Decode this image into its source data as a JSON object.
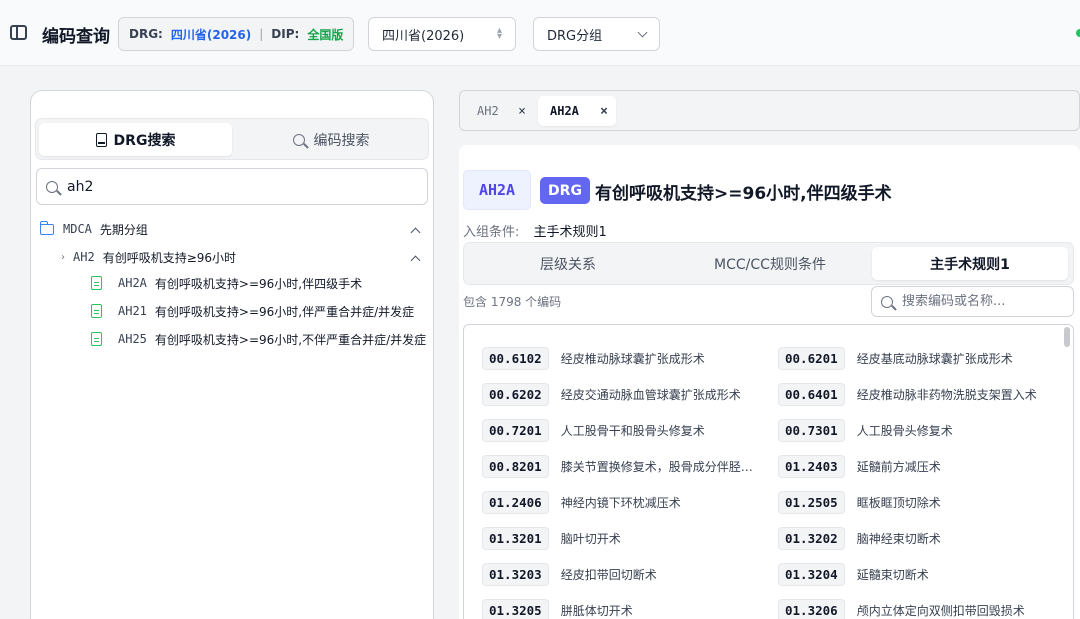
{
  "header": {
    "title": "编码查询",
    "drg_key": "DRG:",
    "drg_value": "四川省(2026)",
    "separator": "|",
    "dip_key": "DIP:",
    "dip_value": "全国版",
    "province_select": "四川省(2026)",
    "group_select": "DRG分组"
  },
  "left": {
    "tabs": [
      "DRG搜索",
      "编码搜索"
    ],
    "search_value": "ah2",
    "tree": {
      "mdca_code": "MDCA",
      "mdca_name": "先期分组",
      "adrg_code": "AH2",
      "adrg_name": "有创呼吸机支持≥96小时",
      "children": [
        {
          "code": "AH2A",
          "name": "有创呼吸机支持>=96小时,伴四级手术"
        },
        {
          "code": "AH21",
          "name": "有创呼吸机支持>=96小时,伴严重合并症/并发症"
        },
        {
          "code": "AH25",
          "name": "有创呼吸机支持>=96小时,不伴严重合并症/并发症"
        }
      ]
    }
  },
  "right": {
    "open_tabs": [
      "AH2",
      "AH2A"
    ],
    "close_glyph": "×",
    "code": "AH2A",
    "type_chip": "DRG",
    "title": "有创呼吸机支持>=96小时,伴四级手术",
    "condition_label": "入组条件:",
    "condition_value": "主手术规则1",
    "segments": [
      "层级关系",
      "MCC/CC规则条件",
      "主手术规则1"
    ],
    "count_text": "包含 1798 个编码",
    "search_placeholder": "搜索编码或名称...",
    "codes": [
      {
        "code": "00.6102",
        "name": "经皮椎动脉球囊扩张成形术"
      },
      {
        "code": "00.6201",
        "name": "经皮基底动脉球囊扩张成形术"
      },
      {
        "code": "00.6202",
        "name": "经皮交通动脉血管球囊扩张成形术"
      },
      {
        "code": "00.6401",
        "name": "经皮椎动脉非药物洗脱支架置入术"
      },
      {
        "code": "00.7201",
        "name": "人工股骨干和股骨头修复术"
      },
      {
        "code": "00.7301",
        "name": "人工股骨头修复术"
      },
      {
        "code": "00.8201",
        "name": "膝关节置换修复术，股骨成分伴胫骨成分"
      },
      {
        "code": "01.2403",
        "name": "延髓前方减压术"
      },
      {
        "code": "01.2406",
        "name": "神经内镜下环枕减压术"
      },
      {
        "code": "01.2505",
        "name": "眶板眶顶切除术"
      },
      {
        "code": "01.3201",
        "name": "脑叶切开术"
      },
      {
        "code": "01.3202",
        "name": "脑神经束切断术"
      },
      {
        "code": "01.3203",
        "name": "经皮扣带回切断术"
      },
      {
        "code": "01.3204",
        "name": "延髓束切断术"
      },
      {
        "code": "01.3205",
        "name": "胼胝体切开术"
      },
      {
        "code": "01.3206",
        "name": "颅内立体定向双侧扣带回毁损术"
      }
    ]
  },
  "colors": {
    "accent": "#6366f1",
    "drg_value": "#2563eb",
    "dip_value": "#16a34a",
    "folder": "#3b82f6",
    "file": "#22c55e"
  }
}
